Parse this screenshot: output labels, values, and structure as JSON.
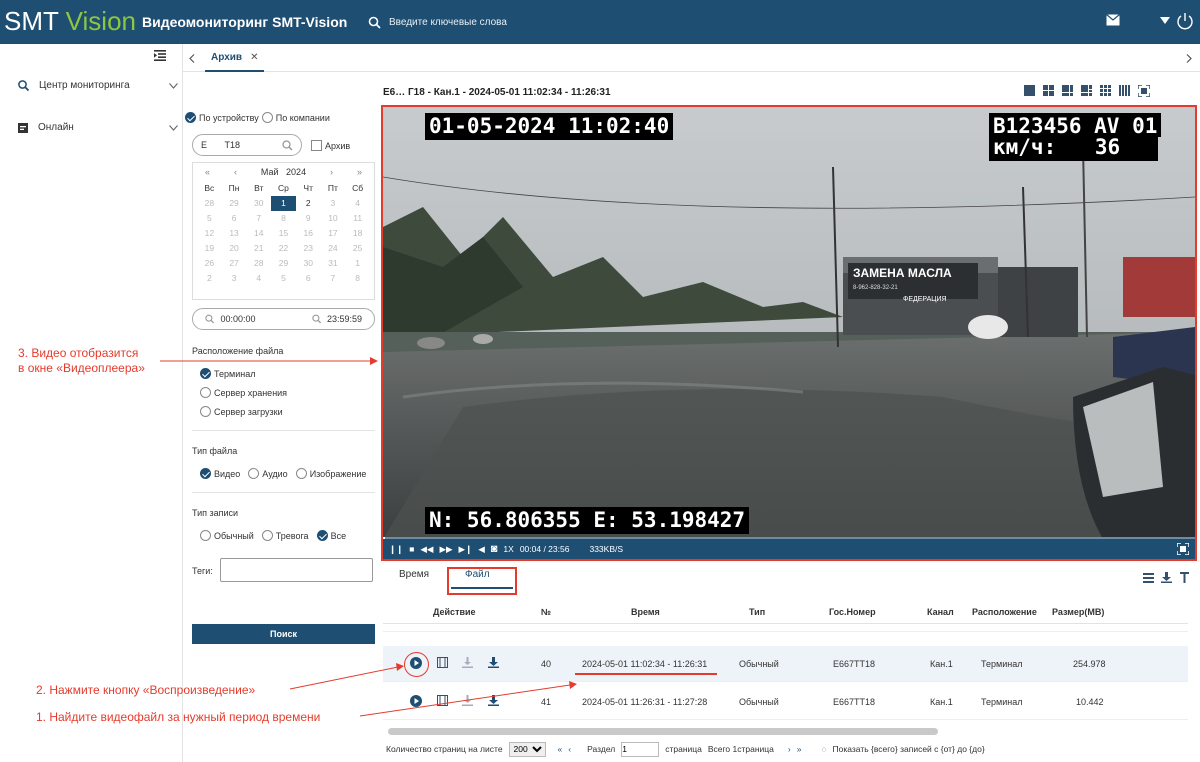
{
  "header": {
    "logo_smt": "SMT",
    "logo_vision": "Vision",
    "app_title": "Видеомониторинг SMT-Vision",
    "search_placeholder": "Введите ключевые слова"
  },
  "sidebar": {
    "items": [
      {
        "label": "Центр мониторинга",
        "icon": "monitor-search-icon"
      },
      {
        "label": "Онлайн",
        "icon": "online-icon"
      }
    ]
  },
  "tabs": [
    {
      "label": "Архив"
    }
  ],
  "filters": {
    "search_by": [
      {
        "label": "По устройству",
        "checked": true
      },
      {
        "label": "По компании",
        "checked": false
      }
    ],
    "device_value": "Е       Т18",
    "archive_label": "Архив",
    "calendar": {
      "month": "Май",
      "year": "2024",
      "weekdays": [
        "Вс",
        "Пн",
        "Вт",
        "Ср",
        "Чт",
        "Пт",
        "Сб"
      ],
      "weeks": [
        [
          "28",
          "29",
          "30",
          "1",
          "2",
          "3",
          "4"
        ],
        [
          "5",
          "6",
          "7",
          "8",
          "9",
          "10",
          "11"
        ],
        [
          "12",
          "13",
          "14",
          "15",
          "16",
          "17",
          "18"
        ],
        [
          "19",
          "20",
          "21",
          "22",
          "23",
          "24",
          "25"
        ],
        [
          "26",
          "27",
          "28",
          "29",
          "30",
          "31",
          "1"
        ],
        [
          "2",
          "3",
          "4",
          "5",
          "6",
          "7",
          "8"
        ]
      ],
      "selected": "1"
    },
    "time_from": "00:00:00",
    "time_to": "23:59:59",
    "location_title": "Расположение файла",
    "location_options": [
      {
        "label": "Терминал",
        "checked": true
      },
      {
        "label": "Сервер хранения",
        "checked": false
      },
      {
        "label": "Сервер загрузки",
        "checked": false
      }
    ],
    "file_type_title": "Тип файла",
    "file_type_options": [
      {
        "label": "Видео",
        "checked": true
      },
      {
        "label": "Аудио",
        "checked": false
      },
      {
        "label": "Изображение",
        "checked": false
      }
    ],
    "record_type_title": "Тип записи",
    "record_type_options": [
      {
        "label": "Обычный",
        "checked": false
      },
      {
        "label": "Тревога",
        "checked": false
      },
      {
        "label": "Все",
        "checked": true
      }
    ],
    "tags_label": "Теги:",
    "search_button": "Поиск"
  },
  "player": {
    "title": "Е6…  Г18 - Кан.1 - 2024-05-01 11:02:34 - 11:26:31",
    "osd_datetime": "01-05-2024 11:02:40",
    "osd_plate": "В123456 AV 01",
    "osd_speed_label": "км/ч:",
    "osd_speed": "36",
    "osd_coords": "N: 56.806355 E: 53.198427",
    "sign_text": "ЗАМЕНА МАСЛА",
    "sign_phone": "8-962-828-32-21",
    "sign_text2": "ФЕДЕРАЦИЯ",
    "speed_mult": "1X",
    "time_position": "00:04 / 23:56",
    "bitrate": "333KB/S",
    "progress": 0.003
  },
  "results": {
    "tabs": [
      "Время",
      "Файл"
    ],
    "columns": [
      "Действие",
      "№",
      "Время",
      "Тип",
      "Гос.Номер",
      "Канал",
      "Расположение",
      "Размер(MB)"
    ],
    "rows": [
      {
        "num": "40",
        "time": "2024-05-01 11:02:34 - 11:26:31",
        "type": "Обычный",
        "plate": "Е667ТТ18",
        "channel": "Кан.1",
        "location": "Терминал",
        "size": "254.978"
      },
      {
        "num": "41",
        "time": "2024-05-01 11:26:31 - 11:27:28",
        "type": "Обычный",
        "plate": "Е667ТТ18",
        "channel": "Кан.1",
        "location": "Терминал",
        "size": "10.442"
      }
    ]
  },
  "pager": {
    "per_page_label": "Количество страниц на листе",
    "per_page": "200",
    "section_label": "Раздел",
    "page": "1",
    "page_word": "страница",
    "total_pages": "Всего 1страница",
    "summary": "Показать {всего} записей с {от} до {до}"
  },
  "annotations": {
    "step3_line1": "3. Видео отобразится",
    "step3_line2": "в окне «Видеоплеера»",
    "step2": "2. Нажмите кнопку «Воспроизведение»",
    "step1": "1. Найдите видеофайл за нужный период времени"
  },
  "colors": {
    "brand": "#1f4e73",
    "accent": "#8dc63f",
    "highlight": "#e53b2c"
  }
}
